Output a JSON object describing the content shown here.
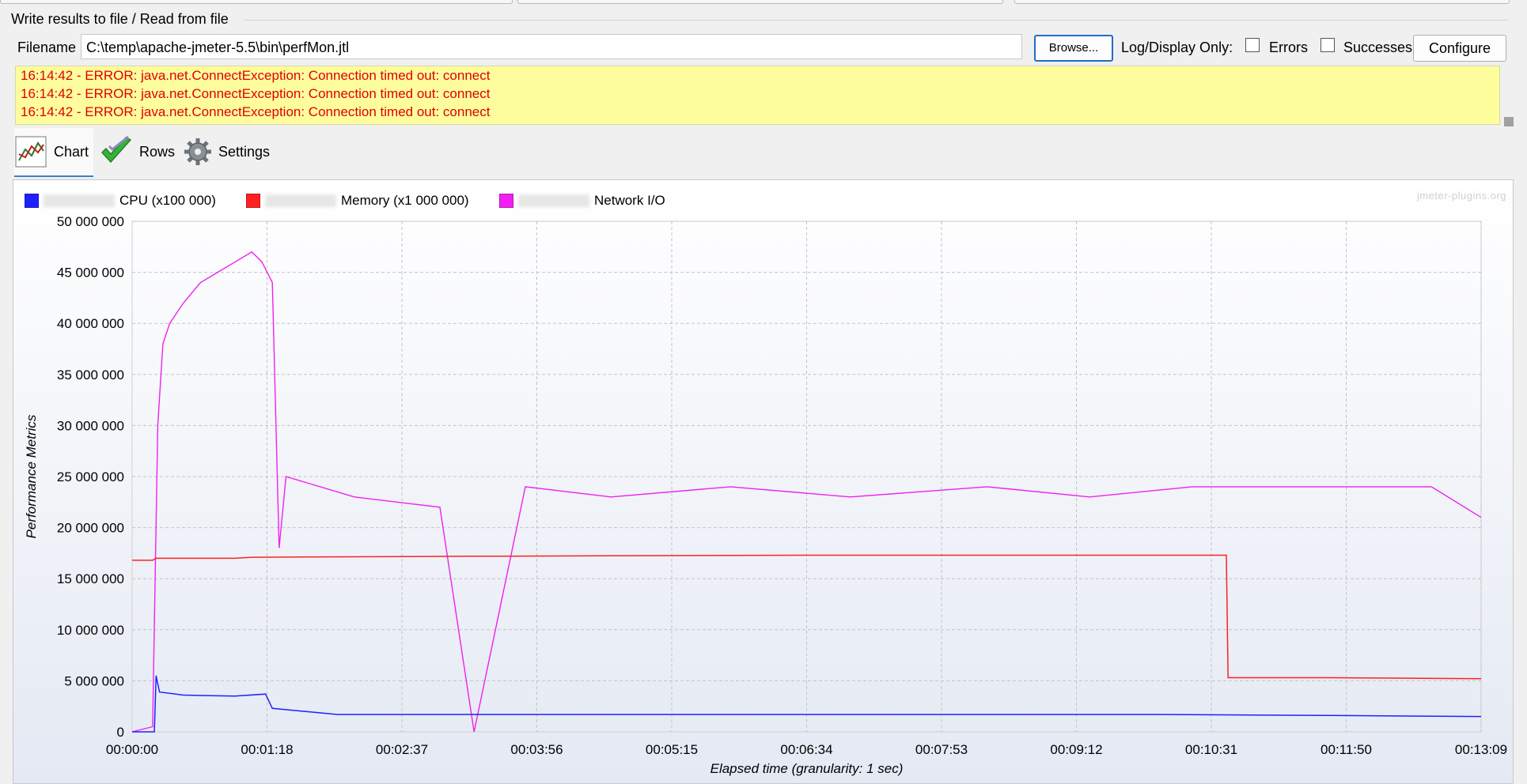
{
  "group": {
    "title": "Write results to file / Read from file",
    "filename_label": "Filename",
    "filename_value": "C:\\temp\\apache-jmeter-5.5\\bin\\perfMon.jtl",
    "browse_label": "Browse...",
    "log_display_label": "Log/Display Only:",
    "errors_label": "Errors",
    "errors_checked": false,
    "successes_label": "Successes",
    "successes_checked": false,
    "configure_label": "Configure"
  },
  "log_lines": [
    "16:14:42 - ERROR: java.net.ConnectException: Connection timed out: connect",
    "16:14:42 - ERROR: java.net.ConnectException: Connection timed out: connect",
    "16:14:42 - ERROR: java.net.ConnectException: Connection timed out: connect"
  ],
  "tabs": [
    {
      "label": "Chart",
      "icon": "chart-icon",
      "active": true
    },
    {
      "label": "Rows",
      "icon": "checkmark-icon",
      "active": false
    },
    {
      "label": "Settings",
      "icon": "gear-icon",
      "active": false
    }
  ],
  "chart_brand": "jmeter-plugins.org",
  "chart_data": {
    "type": "line",
    "ylabel": "Performance Metrics",
    "xlabel": "Elapsed time (granularity: 1 sec)",
    "ylim": [
      0,
      50000000
    ],
    "yticks": [
      "0",
      "5 000 000",
      "10 000 000",
      "15 000 000",
      "20 000 000",
      "25 000 000",
      "30 000 000",
      "35 000 000",
      "40 000 000",
      "45 000 000",
      "50 000 000"
    ],
    "xlim_seconds": [
      0,
      789
    ],
    "xticks": [
      "00:00:00",
      "00:01:18",
      "00:02:37",
      "00:03:56",
      "00:05:15",
      "00:06:34",
      "00:07:53",
      "00:09:12",
      "00:10:31",
      "00:11:50",
      "00:13:09"
    ],
    "grid": true,
    "legend_position": "top-left",
    "series": [
      {
        "name": "CPU (x100 000)",
        "color": "#2020ff",
        "points": [
          [
            0,
            0
          ],
          [
            13,
            0
          ],
          [
            14,
            5500000
          ],
          [
            16,
            3900000
          ],
          [
            30,
            3600000
          ],
          [
            60,
            3500000
          ],
          [
            78,
            3700000
          ],
          [
            82,
            2300000
          ],
          [
            120,
            1700000
          ],
          [
            200,
            1700000
          ],
          [
            300,
            1700000
          ],
          [
            400,
            1700000
          ],
          [
            500,
            1700000
          ],
          [
            600,
            1700000
          ],
          [
            700,
            1600000
          ],
          [
            789,
            1500000
          ]
        ]
      },
      {
        "name": "Memory (x1 000 000)",
        "color": "#ff2020",
        "points": [
          [
            0,
            16800000
          ],
          [
            12,
            16800000
          ],
          [
            14,
            17000000
          ],
          [
            60,
            17000000
          ],
          [
            70,
            17100000
          ],
          [
            200,
            17200000
          ],
          [
            400,
            17300000
          ],
          [
            600,
            17300000
          ],
          [
            640,
            17300000
          ],
          [
            641,
            5300000
          ],
          [
            700,
            5300000
          ],
          [
            789,
            5200000
          ]
        ]
      },
      {
        "name": "Network I/O",
        "color": "#f020f0",
        "points": [
          [
            0,
            0
          ],
          [
            12,
            500000
          ],
          [
            15,
            30000000
          ],
          [
            18,
            38000000
          ],
          [
            22,
            40000000
          ],
          [
            30,
            42000000
          ],
          [
            40,
            44000000
          ],
          [
            50,
            45000000
          ],
          [
            60,
            46000000
          ],
          [
            70,
            47000000
          ],
          [
            76,
            46000000
          ],
          [
            82,
            44000000
          ],
          [
            86,
            18000000
          ],
          [
            90,
            25000000
          ],
          [
            130,
            23000000
          ],
          [
            180,
            22000000
          ],
          [
            200,
            0
          ],
          [
            230,
            24000000
          ],
          [
            280,
            23000000
          ],
          [
            350,
            24000000
          ],
          [
            420,
            23000000
          ],
          [
            500,
            24000000
          ],
          [
            560,
            23000000
          ],
          [
            620,
            24000000
          ],
          [
            700,
            24000000
          ],
          [
            760,
            24000000
          ],
          [
            789,
            21000000
          ]
        ]
      }
    ]
  }
}
